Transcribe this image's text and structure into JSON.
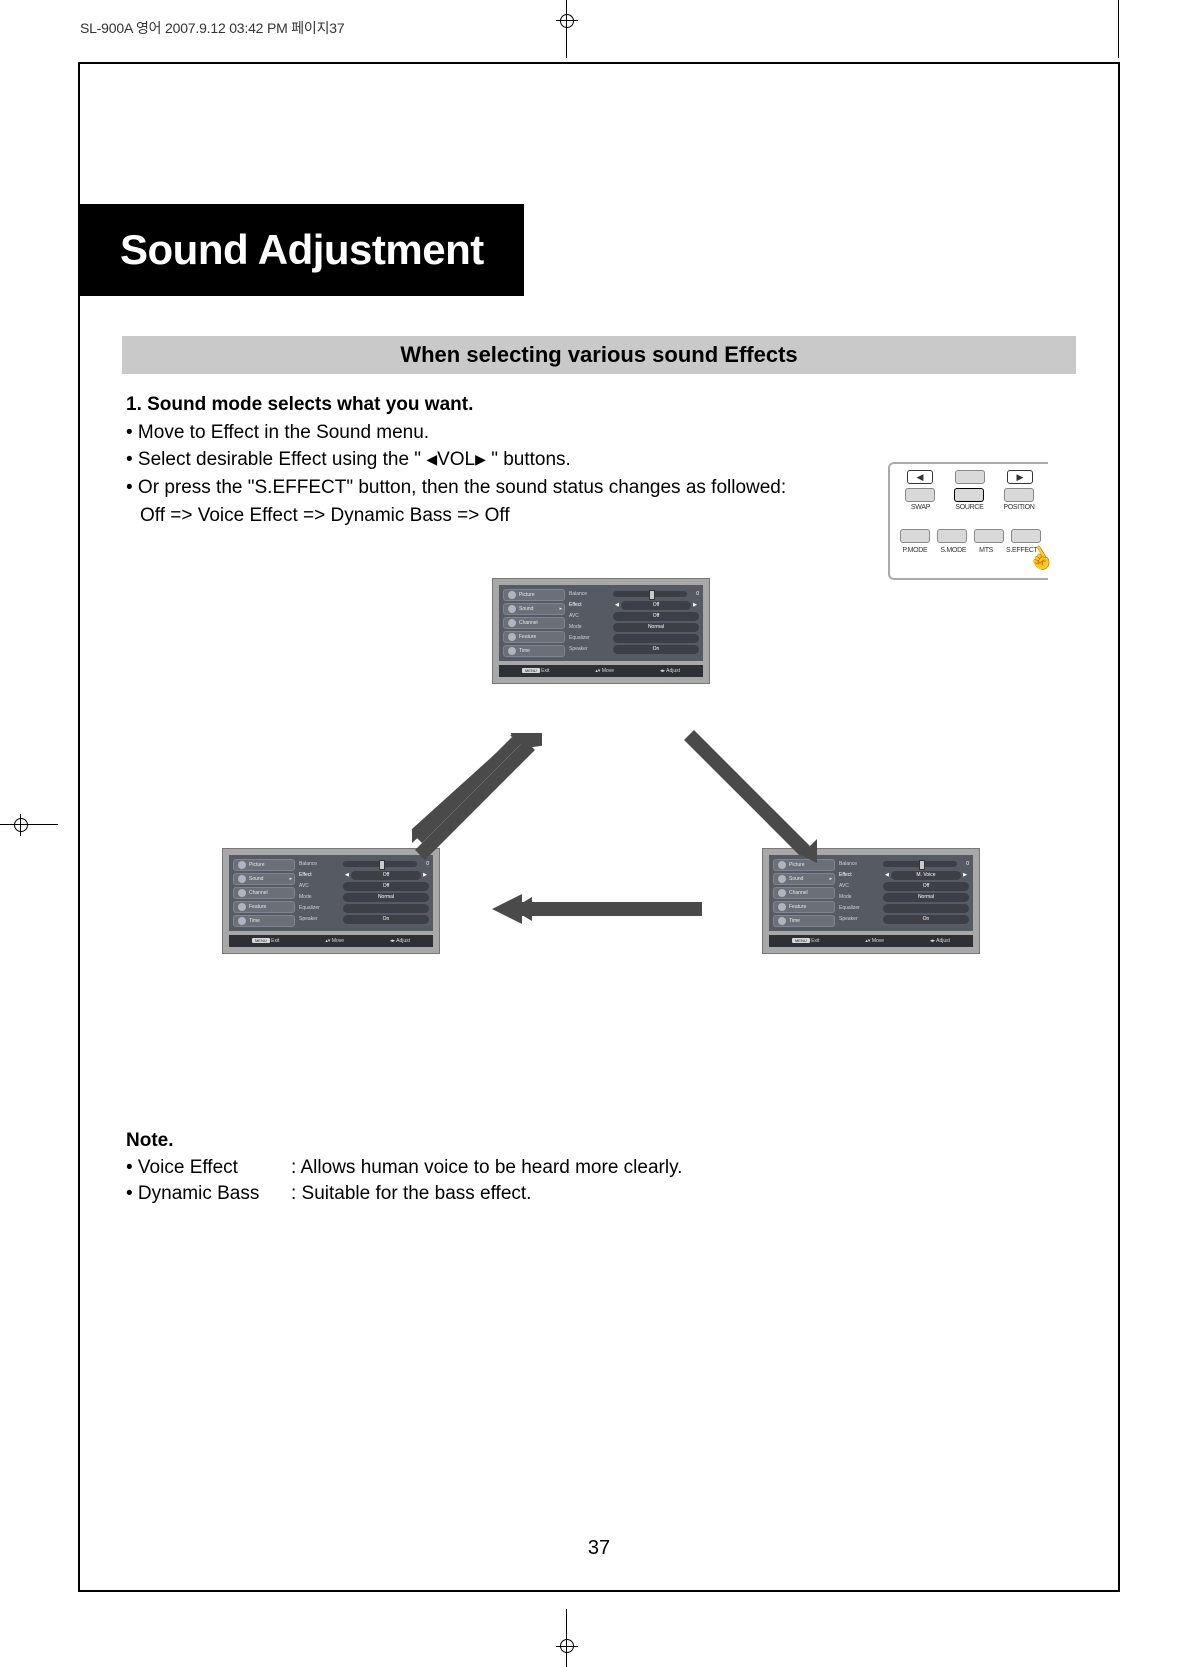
{
  "header_strip": "SL-900A 영어  2007.9.12 03:42 PM  페이지37",
  "title": "Sound Adjustment",
  "section_heading": "When selecting various sound Effects",
  "step_heading": "1. Sound mode selects what you want.",
  "bullets": {
    "b1": "• Move to Effect in the Sound menu.",
    "b2_pre": "• Select desirable Effect using the \" ",
    "b2_vol": "VOL",
    "b2_post": " \" buttons.",
    "b3": "• Or press the \"S.EFFECT\" button, then the sound status changes as followed:",
    "b3_seq": "Off => Voice Effect => Dynamic Bass => Off"
  },
  "remote": {
    "top_row": {
      "l": "◀",
      "m": "",
      "r": "▶"
    },
    "row1": {
      "a": "SWAP",
      "b": "SOURCE",
      "c": "POSITION"
    },
    "row2": {
      "a": "P.MODE",
      "b": "S.MODE",
      "c": "MTS",
      "d": "S.EFFECT"
    }
  },
  "osd": {
    "menu": [
      "Picture",
      "Sound",
      "Channel",
      "Feature",
      "Time"
    ],
    "opts": [
      "Balance",
      "Effect",
      "AVC",
      "Mode",
      "Equalizer",
      "Speaker"
    ],
    "vals_generic": {
      "avc": "Off",
      "mode": "Normal",
      "speaker": "On",
      "balance_num": "0"
    },
    "effect_top": "Off",
    "effect_left": "Off",
    "effect_right": "M. Voice",
    "foot": {
      "exit": "Exit",
      "move": "Move",
      "adjust": "Adjust",
      "menu": "MENU"
    }
  },
  "note": {
    "head": "Note.",
    "r1k": "• Voice Effect",
    "r1v": ": Allows human voice to be heard more clearly.",
    "r2k": "• Dynamic Bass",
    "r2v": ": Suitable for the bass effect."
  },
  "page_number": "37"
}
